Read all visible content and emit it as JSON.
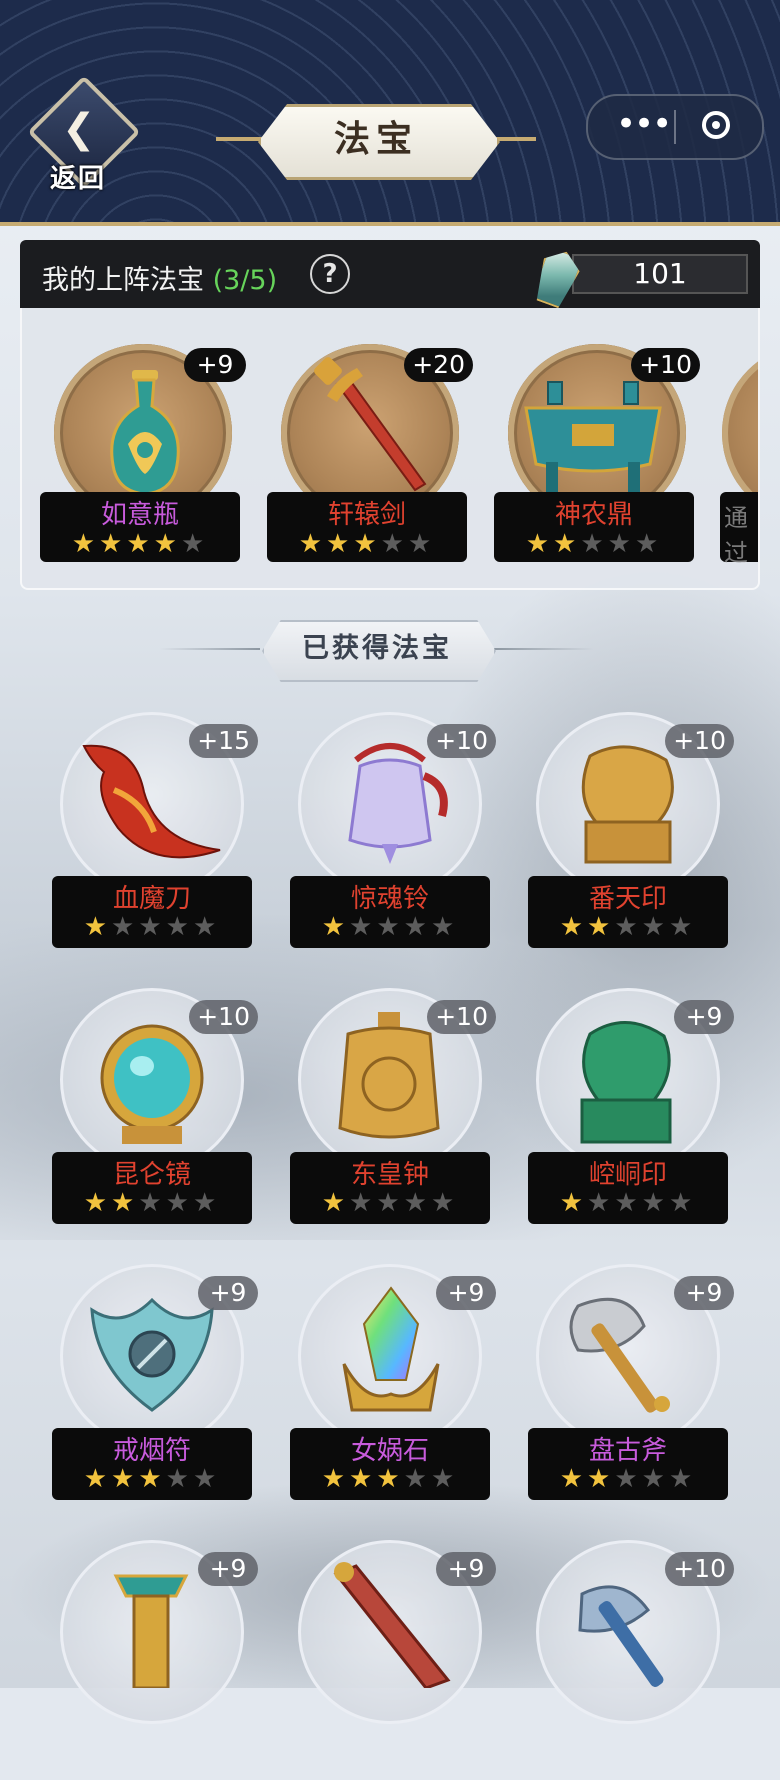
{
  "header": {
    "back_label": "返回",
    "title": "法宝",
    "menu_glyph": "•••"
  },
  "deployed": {
    "title": "我的上阵法宝",
    "count": "(3/5)",
    "help_glyph": "?",
    "currency_value": "101",
    "items": [
      {
        "name": "如意瓶",
        "level": "+9",
        "stars": 4,
        "icon": "vase-icon"
      },
      {
        "name": "轩辕剑",
        "level": "+20",
        "stars": 3,
        "icon": "sword-icon"
      },
      {
        "name": "神农鼎",
        "level": "+10",
        "stars": 2,
        "icon": "cauldron-icon"
      }
    ],
    "clipped_label": "通过"
  },
  "owned_section_title": "已获得法宝",
  "owned": [
    {
      "name": "血魔刀",
      "level": "+15",
      "stars": 1,
      "name_color": "red",
      "icon": "blade-icon"
    },
    {
      "name": "惊魂铃",
      "level": "+10",
      "stars": 1,
      "name_color": "red",
      "icon": "bell-icon"
    },
    {
      "name": "番天印",
      "level": "+10",
      "stars": 2,
      "name_color": "red",
      "icon": "seal-icon"
    },
    {
      "name": "昆仑镜",
      "level": "+10",
      "stars": 2,
      "name_color": "red",
      "icon": "mirror-icon"
    },
    {
      "name": "东皇钟",
      "level": "+10",
      "stars": 1,
      "name_color": "red",
      "icon": "bronze-bell-icon"
    },
    {
      "name": "崆峒印",
      "level": "+9",
      "stars": 1,
      "name_color": "red",
      "icon": "jade-seal-icon"
    },
    {
      "name": "戒烟符",
      "level": "+9",
      "stars": 3,
      "name_color": "purple",
      "icon": "talisman-icon"
    },
    {
      "name": "女娲石",
      "level": "+9",
      "stars": 3,
      "name_color": "purple",
      "icon": "crystal-icon"
    },
    {
      "name": "盘古斧",
      "level": "+9",
      "stars": 2,
      "name_color": "purple",
      "icon": "axe-icon"
    },
    {
      "name": "",
      "level": "+9",
      "stars": 0,
      "name_color": "purple",
      "icon": "tower-icon"
    },
    {
      "name": "",
      "level": "+9",
      "stars": 0,
      "name_color": "purple",
      "icon": "lute-icon"
    },
    {
      "name": "",
      "level": "+10",
      "stars": 0,
      "name_color": "purple",
      "icon": "halberd-icon"
    }
  ],
  "colors": {
    "header_bg": "#1d2b4b",
    "gold": "#c6ab72",
    "star_on": "#f2c33e",
    "star_off": "#5d5d5d",
    "name_red": "#e0422f",
    "name_purple": "#c85bdc",
    "count_green": "#67d45b"
  }
}
